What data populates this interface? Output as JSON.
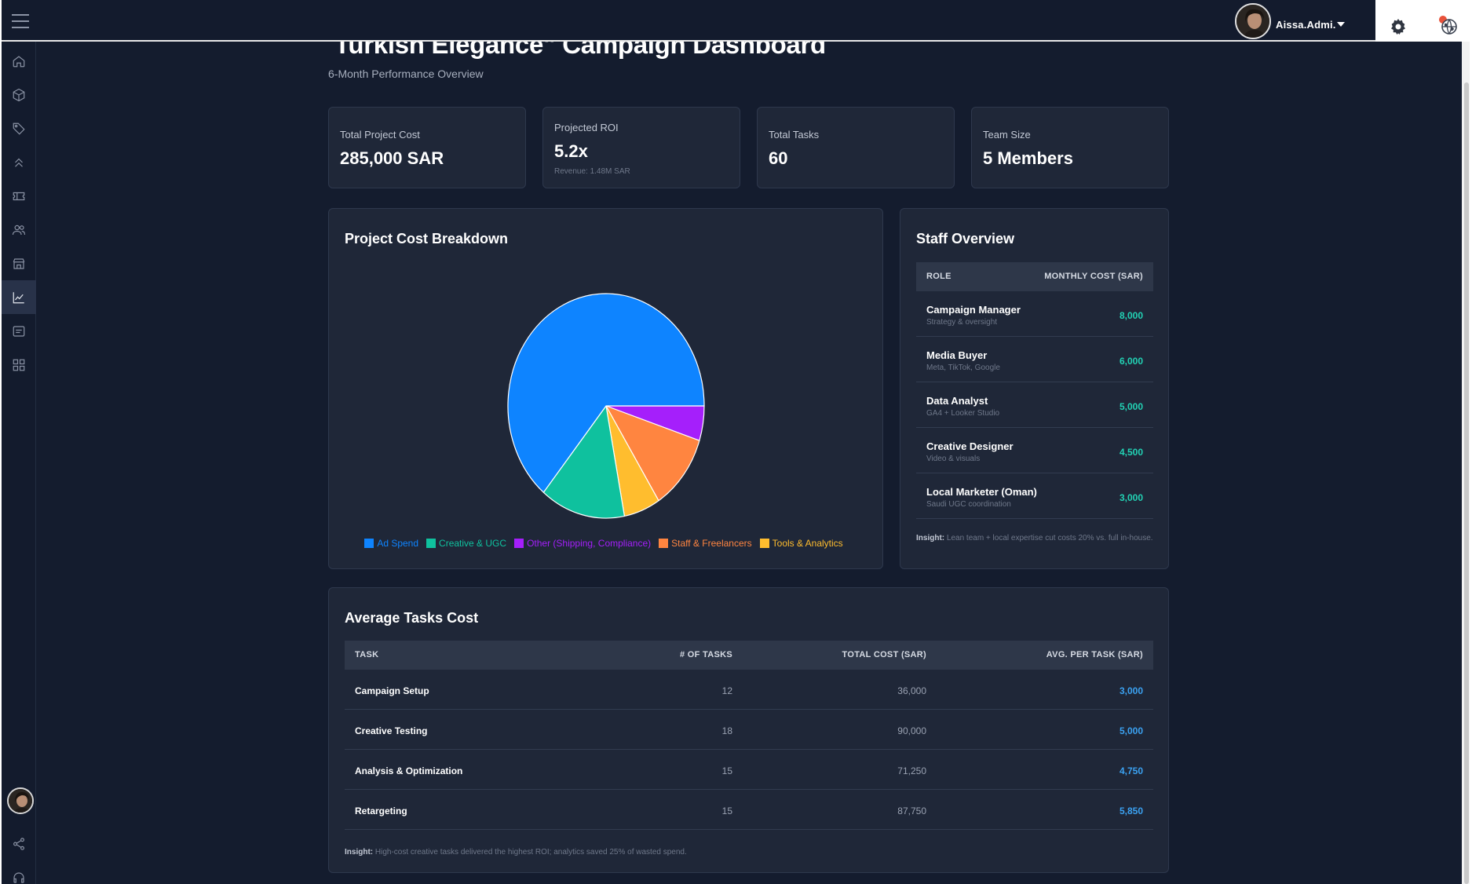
{
  "header": {
    "user_name": "Aissa.Admi.",
    "icons": [
      "menu-icon",
      "avatar",
      "chevron-down-icon",
      "gear-icon",
      "globe-icon"
    ]
  },
  "sidebar": {
    "items": [
      "home-icon",
      "cube-icon",
      "tag-icon",
      "chevrons-up-icon",
      "ticket-icon",
      "users-icon",
      "store-icon",
      "chart-line-icon",
      "message-icon",
      "grid-icon"
    ],
    "active": "chart-line-icon",
    "bottom": [
      "avatar",
      "share-icon",
      "headset-icon",
      "gear-icon"
    ]
  },
  "page": {
    "title": "Turkish Elegance\" Campaign Dashboard",
    "subtitle": "6-Month Performance Overview"
  },
  "stats": [
    {
      "label": "Total Project Cost",
      "value": "285,000 SAR",
      "note": ""
    },
    {
      "label": "Projected ROI",
      "value": "5.2x",
      "note": "Revenue: 1.48M SAR"
    },
    {
      "label": "Total Tasks",
      "value": "60",
      "note": ""
    },
    {
      "label": "Team Size",
      "value": "5 Members",
      "note": ""
    }
  ],
  "cost_breakdown": {
    "title": "Project Cost Breakdown"
  },
  "chart_data": {
    "type": "pie",
    "title": "Project Cost Breakdown",
    "categories": [
      "Ad Spend",
      "Creative & UGC",
      "Other (Shipping, Compliance)",
      "Staff & Freelancers",
      "Tools & Analytics"
    ],
    "values": [
      64,
      14,
      5,
      11,
      6
    ],
    "slice_order_clockwise_from_right": [
      "Other (Shipping, Compliance)",
      "Staff & Freelancers",
      "Tools & Analytics",
      "Creative & UGC",
      "Ad Spend"
    ],
    "colors": [
      "#0e84ff",
      "#0fc19e",
      "#a51ffb",
      "#ff8540",
      "#ffbd2e"
    ],
    "legend_position": "bottom"
  },
  "staff": {
    "title": "Staff Overview",
    "col_role": "ROLE",
    "col_cost": "MONTHLY COST (SAR)",
    "rows": [
      {
        "role": "Campaign Manager",
        "desc": "Strategy & oversight",
        "cost": "8,000"
      },
      {
        "role": "Media Buyer",
        "desc": "Meta, TikTok, Google",
        "cost": "6,000"
      },
      {
        "role": "Data Analyst",
        "desc": "GA4 + Looker Studio",
        "cost": "5,000"
      },
      {
        "role": "Creative Designer",
        "desc": "Video & visuals",
        "cost": "4,500"
      },
      {
        "role": "Local Marketer (Oman)",
        "desc": "Saudi UGC coordination",
        "cost": "3,000"
      }
    ],
    "insight_label": "Insight:",
    "insight_text": "Lean team + local expertise cut costs 20% vs. full in-house."
  },
  "tasks": {
    "title": "Average Tasks Cost",
    "columns": [
      "TASK",
      "# OF TASKS",
      "TOTAL COST (SAR)",
      "AVG. PER TASK (SAR)"
    ],
    "rows": [
      {
        "task": "Campaign Setup",
        "count": "12",
        "total": "36,000",
        "avg": "3,000"
      },
      {
        "task": "Creative Testing",
        "count": "18",
        "total": "90,000",
        "avg": "5,000"
      },
      {
        "task": "Analysis & Optimization",
        "count": "15",
        "total": "71,250",
        "avg": "4,750"
      },
      {
        "task": "Retargeting",
        "count": "15",
        "total": "87,750",
        "avg": "5,850"
      }
    ],
    "insight_label": "Insight:",
    "insight_text": "High-cost creative tasks delivered the highest ROI; analytics saved 25% of wasted spend."
  }
}
